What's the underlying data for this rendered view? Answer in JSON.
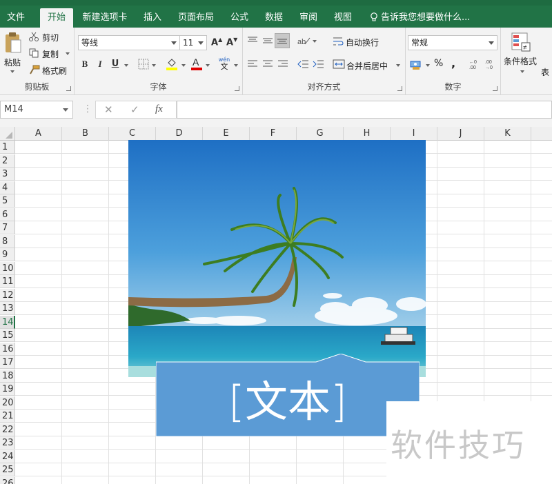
{
  "menu": {
    "tabs": [
      "文件",
      "开始",
      "新建选项卡",
      "插入",
      "页面布局",
      "公式",
      "数据",
      "审阅",
      "视图"
    ],
    "active_tab": "开始",
    "tell_me": "告诉我您想要做什么..."
  },
  "ribbon": {
    "clipboard": {
      "paste": "粘贴",
      "cut": "剪切",
      "copy": "复制",
      "format_painter": "格式刷",
      "group_label": "剪贴板"
    },
    "font": {
      "font_name": "等线",
      "font_size": "11",
      "group_label": "字体",
      "bold": "B",
      "italic": "I",
      "underline": "U",
      "pinyin_top": "wén",
      "pinyin_bottom": "文"
    },
    "alignment": {
      "wrap_text": "自动换行",
      "merge_center": "合并后居中",
      "group_label": "对齐方式"
    },
    "number": {
      "format": "常规",
      "percent": "%",
      "comma": ",",
      "group_label": "数字"
    },
    "styles": {
      "conditional_format": "条件格式",
      "cut_off": "表"
    }
  },
  "formula_bar": {
    "name_box": "M14",
    "cancel": "✕",
    "enter": "✓",
    "fx": "fx",
    "value": ""
  },
  "grid": {
    "columns": [
      "A",
      "B",
      "C",
      "D",
      "E",
      "F",
      "G",
      "H",
      "I",
      "J",
      "K"
    ],
    "rows": [
      "1",
      "2",
      "3",
      "4",
      "5",
      "6",
      "7",
      "8",
      "9",
      "10",
      "11",
      "12",
      "13",
      "14",
      "15",
      "16",
      "17",
      "18",
      "19",
      "20",
      "21",
      "22",
      "23",
      "24",
      "25",
      "26"
    ],
    "selected_row": "14"
  },
  "textbox": {
    "text": "[文本]"
  },
  "watermark": {
    "text": "软件技巧"
  },
  "colors": {
    "accent": "#217346",
    "textbox_fill": "#5b9bd5",
    "sky_top": "#1e6fc4",
    "sea": "#2a9fc8"
  }
}
